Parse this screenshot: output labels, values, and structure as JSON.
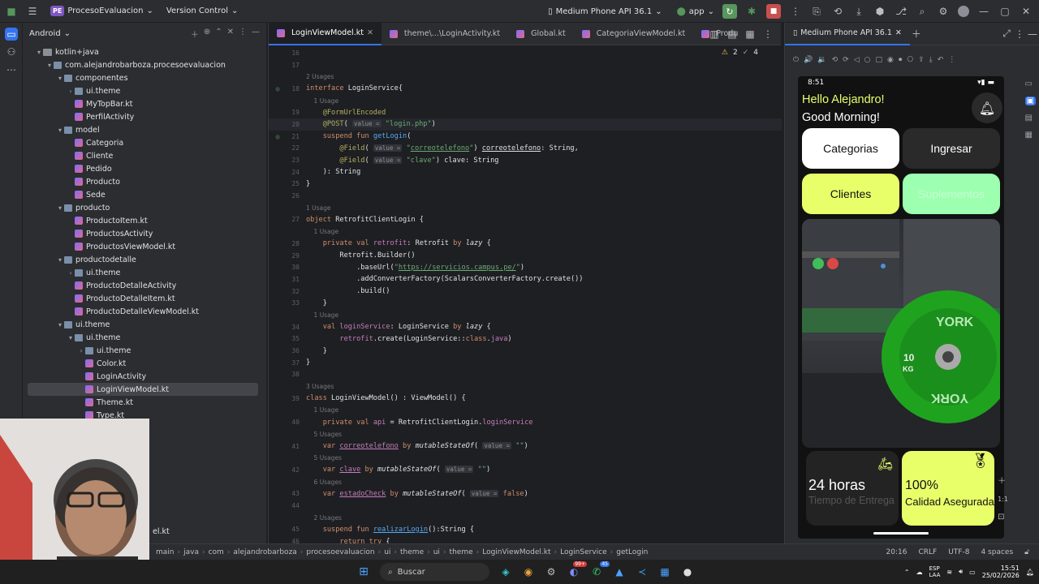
{
  "topbar": {
    "project_badge": "PE",
    "project_name": "ProcesoEvaluacion",
    "vcs": "Version Control",
    "device": "Medium Phone API 36.1",
    "config": "app"
  },
  "project_panel": {
    "view_mode": "Android",
    "tree": [
      {
        "label": "kotlin+java",
        "depth": 1,
        "type": "folder",
        "open": true
      },
      {
        "label": "com.alejandrobarboza.procesoevaluacion",
        "depth": 2,
        "type": "pkg",
        "open": true
      },
      {
        "label": "componentes",
        "depth": 3,
        "type": "pkg",
        "open": true
      },
      {
        "label": "ui.theme",
        "depth": 4,
        "type": "pkg",
        "open": false
      },
      {
        "label": "MyTopBar.kt",
        "depth": 4,
        "type": "kt"
      },
      {
        "label": "PerfilActivity",
        "depth": 4,
        "type": "kt"
      },
      {
        "label": "model",
        "depth": 3,
        "type": "pkg",
        "open": true
      },
      {
        "label": "Categoria",
        "depth": 4,
        "type": "kt"
      },
      {
        "label": "Cliente",
        "depth": 4,
        "type": "kt"
      },
      {
        "label": "Pedido",
        "depth": 4,
        "type": "kt"
      },
      {
        "label": "Producto",
        "depth": 4,
        "type": "kt"
      },
      {
        "label": "Sede",
        "depth": 4,
        "type": "kt"
      },
      {
        "label": "producto",
        "depth": 3,
        "type": "pkg",
        "open": true
      },
      {
        "label": "ProductoItem.kt",
        "depth": 4,
        "type": "kt"
      },
      {
        "label": "ProductosActivity",
        "depth": 4,
        "type": "kt"
      },
      {
        "label": "ProductosViewModel.kt",
        "depth": 4,
        "type": "kt"
      },
      {
        "label": "productodetalle",
        "depth": 3,
        "type": "pkg",
        "open": true
      },
      {
        "label": "ui.theme",
        "depth": 4,
        "type": "pkg",
        "open": false
      },
      {
        "label": "ProductoDetalleActivity",
        "depth": 4,
        "type": "kt"
      },
      {
        "label": "ProductoDetalleItem.kt",
        "depth": 4,
        "type": "kt"
      },
      {
        "label": "ProductoDetalleViewModel.kt",
        "depth": 4,
        "type": "kt"
      },
      {
        "label": "ui.theme",
        "depth": 3,
        "type": "pkg",
        "open": true
      },
      {
        "label": "ui.theme",
        "depth": 4,
        "type": "pkg",
        "open": true
      },
      {
        "label": "ui.theme",
        "depth": 5,
        "type": "pkg",
        "open": false
      },
      {
        "label": "Color.kt",
        "depth": 5,
        "type": "kt"
      },
      {
        "label": "LoginActivity",
        "depth": 5,
        "type": "kt"
      },
      {
        "label": "LoginViewModel.kt",
        "depth": 5,
        "type": "kt",
        "selected": true
      },
      {
        "label": "Theme.kt",
        "depth": 5,
        "type": "kt"
      },
      {
        "label": "Type.kt",
        "depth": 5,
        "type": "kt"
      }
    ],
    "partial_label": "el.kt"
  },
  "editor": {
    "tabs": [
      "LoginViewModel.kt",
      "theme\\...\\LoginActivity.kt",
      "Global.kt",
      "CategoriaViewModel.kt",
      "Produ"
    ],
    "warnings": "2",
    "checks": "4"
  },
  "run_panel": {
    "tab": "Medium Phone API 36.1"
  },
  "phone": {
    "time": "8:51",
    "greeting": "Hello Alejandro!",
    "subgreeting": "Good Morning!",
    "buttons": {
      "categorias": "Categorias",
      "ingresar": "Ingresar",
      "clientes": "Clientes",
      "suplementos": "Suplementos"
    },
    "plate_text": "YORK",
    "plate_weight": "10",
    "plate_unit": "KG",
    "card1_value": "24 horas",
    "card1_label": "Tiempo de Entrega",
    "card2_value": "100%",
    "card2_label": "Calidad Asegurada",
    "colors": {
      "lime": "#e8ff6a",
      "mint": "#9dffb0",
      "white": "#ffffff",
      "dark": "#2a2a2a",
      "plate": "#1fa31f"
    }
  },
  "statusbar": {
    "crumbs": [
      "main",
      "java",
      "com",
      "alejandrobarboza",
      "procesoevaluacion",
      "ui",
      "theme",
      "ui",
      "theme",
      "LoginViewModel.kt",
      "LoginService",
      "getLogin"
    ],
    "position": "20:16",
    "line_sep": "CRLF",
    "encoding": "UTF-8",
    "indent": "4 spaces"
  },
  "taskbar": {
    "search": "Buscar",
    "lang": "ESP",
    "lang2": "LAA",
    "time": "15:51",
    "date": "25/02/2026",
    "badge1": "99+",
    "badge2": "45"
  }
}
